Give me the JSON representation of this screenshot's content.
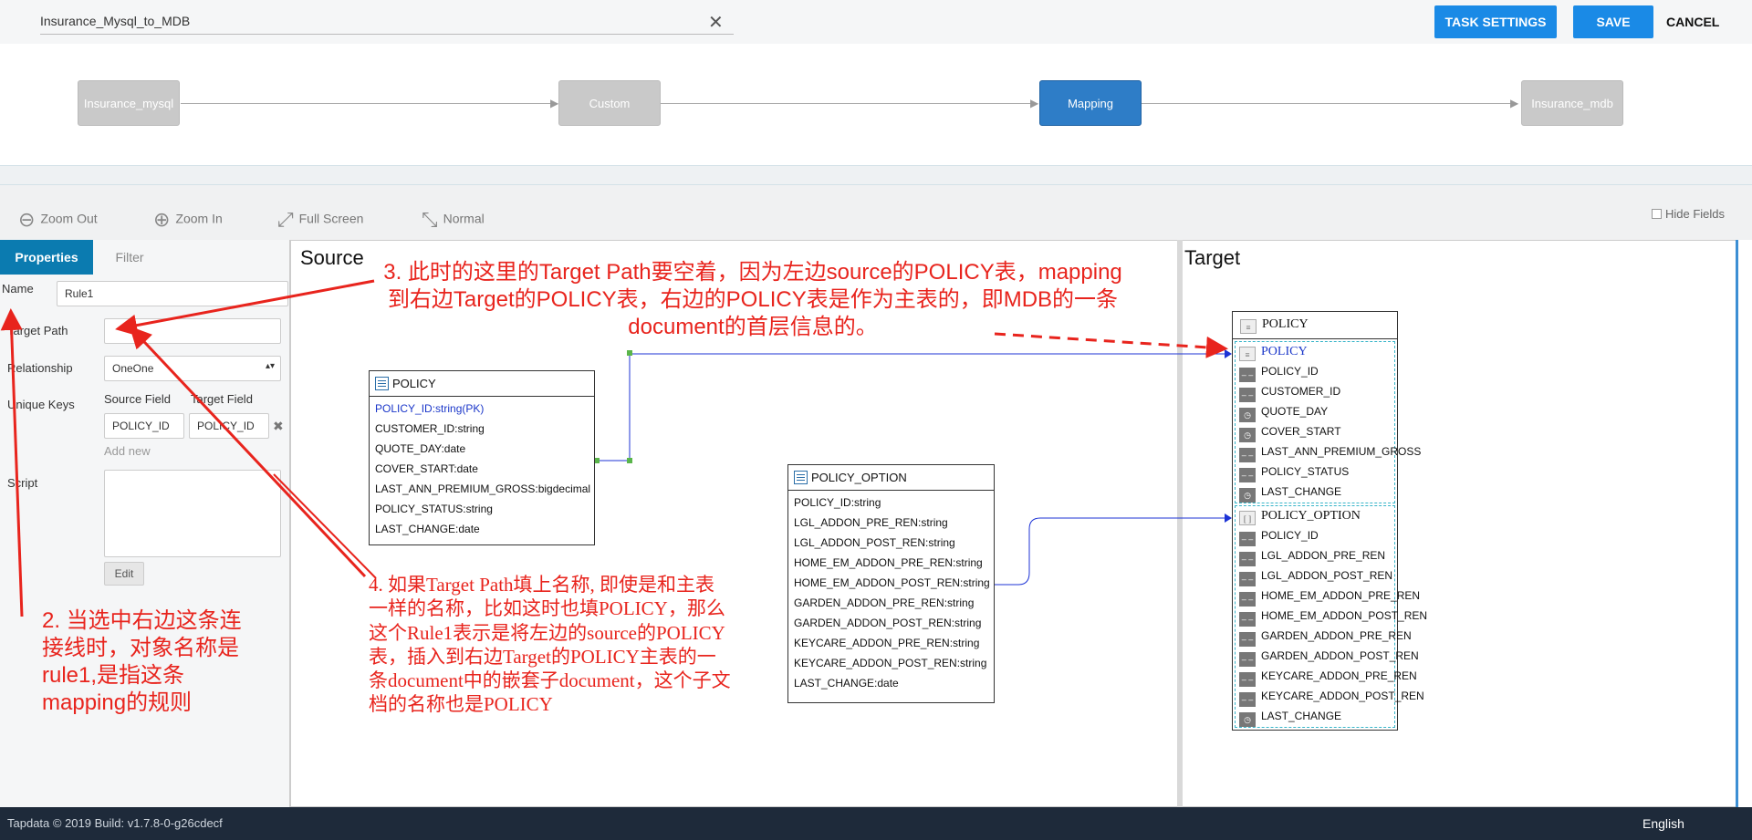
{
  "topbar": {
    "task_name": "Insurance_Mysql_to_MDB",
    "task_settings_label": "TASK SETTINGS",
    "save_label": "SAVE",
    "cancel_label": "CANCEL"
  },
  "flow": {
    "nodes": [
      {
        "label": "Insurance_mysql",
        "active": false
      },
      {
        "label": "Custom",
        "active": false
      },
      {
        "label": "Mapping",
        "active": true
      },
      {
        "label": "Insurance_mdb",
        "active": false
      }
    ]
  },
  "toolbar": {
    "zoom_out": "Zoom Out",
    "zoom_in": "Zoom In",
    "full_screen": "Full Screen",
    "normal": "Normal",
    "hide_fields": "Hide Fields"
  },
  "properties": {
    "tabs": [
      "Properties",
      "Filter"
    ],
    "name_label": "Name",
    "name_value": "Rule1",
    "target_path_label": "Target Path",
    "target_path_value": "",
    "relationship_label": "Relationship",
    "relationship_value": "OneOne",
    "unique_keys_label": "Unique Keys",
    "source_field_label": "Source Field",
    "target_field_label": "Target Field",
    "source_field_value": "POLICY_ID",
    "target_field_value": "POLICY_ID",
    "add_new": "Add new",
    "script_label": "Script",
    "edit_label": "Edit"
  },
  "canvas": {
    "source_title": "Source",
    "target_title": "Target",
    "source_tables": [
      {
        "name": "POLICY",
        "fields": [
          "POLICY_ID:string(PK)",
          "CUSTOMER_ID:string",
          "QUOTE_DAY:date",
          "COVER_START:date",
          "LAST_ANN_PREMIUM_GROSS:bigdecimal",
          "POLICY_STATUS:string",
          "LAST_CHANGE:date"
        ]
      },
      {
        "name": "POLICY_OPTION",
        "fields": [
          "POLICY_ID:string",
          "LGL_ADDON_PRE_REN:string",
          "LGL_ADDON_POST_REN:string",
          "HOME_EM_ADDON_PRE_REN:string",
          "HOME_EM_ADDON_POST_REN:string",
          "GARDEN_ADDON_PRE_REN:string",
          "GARDEN_ADDON_POST_REN:string",
          "KEYCARE_ADDON_PRE_REN:string",
          "KEYCARE_ADDON_POST_REN:string",
          "LAST_CHANGE:date"
        ]
      }
    ],
    "target": {
      "name": "POLICY",
      "groups": [
        {
          "name": "POLICY",
          "items": [
            "POLICY_ID",
            "CUSTOMER_ID",
            "QUOTE_DAY",
            "COVER_START",
            "LAST_ANN_PREMIUM_GROSS",
            "POLICY_STATUS",
            "LAST_CHANGE"
          ]
        },
        {
          "name": "POLICY_OPTION",
          "items": [
            "POLICY_ID",
            "LGL_ADDON_PRE_REN",
            "LGL_ADDON_POST_REN",
            "HOME_EM_ADDON_PRE_REN",
            "HOME_EM_ADDON_POST_REN",
            "GARDEN_ADDON_PRE_REN",
            "GARDEN_ADDON_POST_REN",
            "KEYCARE_ADDON_PRE_REN",
            "KEYCARE_ADDON_POST_REN",
            "LAST_CHANGE"
          ]
        }
      ]
    }
  },
  "annotations": {
    "note2": "2. 当选中右边这条连接线时，对象名称是rule1,是指这条mapping的规则",
    "note3": "3. 此时的这里的Target Path要空着，因为左边source的POLICY表，mapping到右边Target的POLICY表，右边的POLICY表是作为主表的，即MDB的一条document的首层信息的。",
    "note4": "4. 如果Target Path填上名称, 即使是和主表一样的名称，比如这时也填POLICY，那么这个Rule1表示是将左边的source的POLICY表，插入到右边Target的POLICY主表的一条document中的嵌套子document，这个子文档的名称也是POLICY"
  },
  "footer": {
    "copyright": "Tapdata © 2019 Build: v1.7.8-0-g26cdecf",
    "language": "English"
  },
  "colors": {
    "primary": "#1a8ae6",
    "tab_active": "#0b7bb0",
    "node_active": "#2e7dc7",
    "annotation": "#e8241d",
    "link_line": "#1c33d6"
  }
}
